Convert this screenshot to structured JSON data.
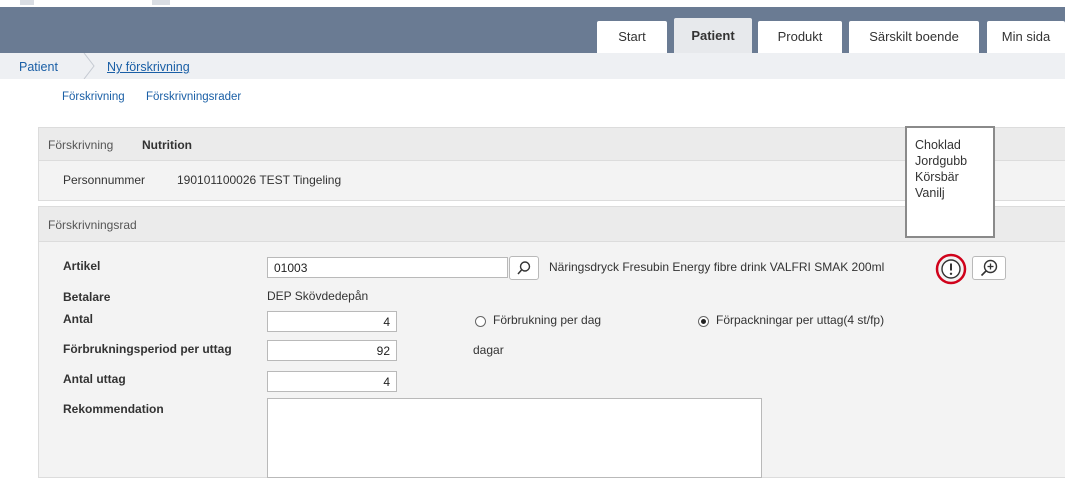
{
  "nav": {
    "tabs": [
      {
        "label": "Start"
      },
      {
        "label": "Patient"
      },
      {
        "label": "Produkt"
      },
      {
        "label": "Särskilt boende"
      },
      {
        "label": "Min sida"
      }
    ],
    "active_tab": "Patient"
  },
  "breadcrumb": {
    "root": "Patient",
    "current": "Ny förskrivning"
  },
  "subnav": {
    "forskrivning": "Förskrivning",
    "forskrivningsrader": "Förskrivningsrader"
  },
  "prescription": {
    "header_label": "Förskrivning",
    "header_value": "Nutrition",
    "personnummer_label": "Personnummer",
    "personnummer_value": "190101100026 TEST Tingeling"
  },
  "row": {
    "header": "Förskrivningsrad",
    "artikel_label": "Artikel",
    "artikel_value": "01003",
    "artikel_description": "Näringsdryck Fresubin Energy fibre drink VALFRI SMAK 200ml",
    "betalare_label": "Betalare",
    "betalare_value": "DEP Skövdedepån",
    "antal_label": "Antal",
    "antal_value": "4",
    "radio_per_dag": "Förbrukning per dag",
    "radio_per_uttag": "Förpackningar per uttag(4 st/fp)",
    "radio_selected": "Förpackningar per uttag(4 st/fp)",
    "period_label": "Förbrukningsperiod per uttag",
    "period_value": "92",
    "period_unit": "dagar",
    "uttag_label": "Antal uttag",
    "uttag_value": "4",
    "rekommendation_label": "Rekommendation",
    "rekommendation_value": ""
  },
  "tooltip": {
    "flavors": [
      "Choklad",
      "Jordgubb",
      "Körsbär",
      "Vanilj"
    ]
  },
  "colors": {
    "topbar": "#6a7b93",
    "link": "#1a5fa6",
    "highlight": "#d0021b"
  }
}
